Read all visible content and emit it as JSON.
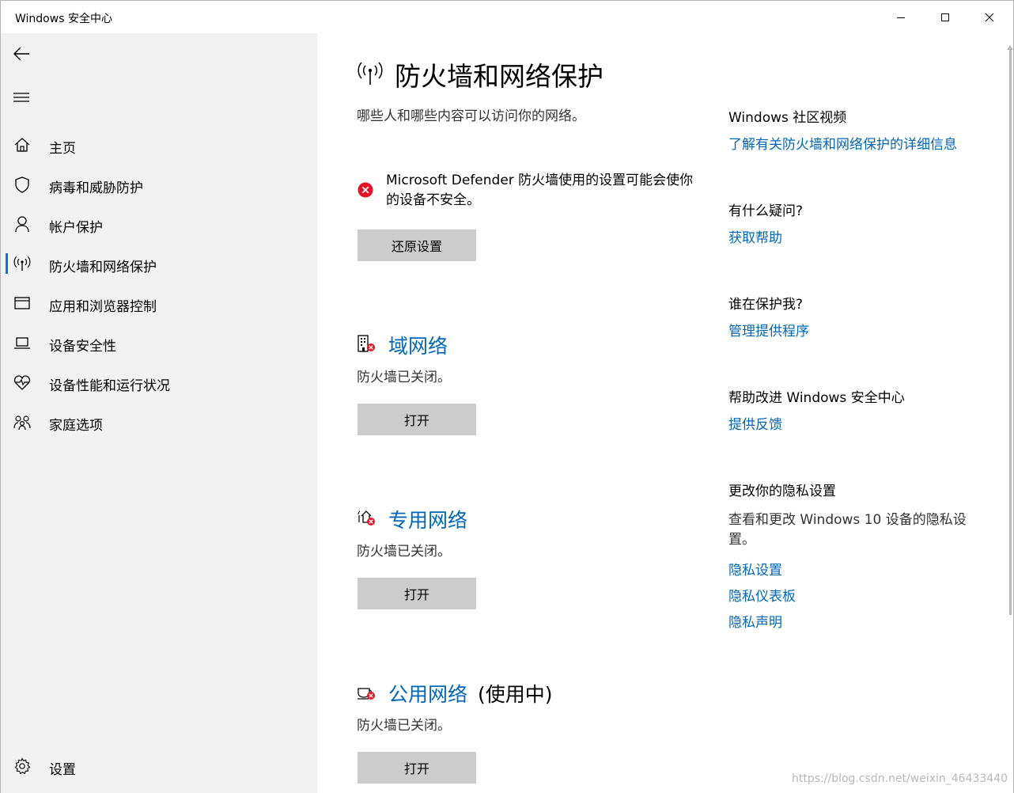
{
  "window": {
    "title": "Windows 安全中心"
  },
  "sidebar": {
    "items": [
      {
        "label": "主页",
        "icon": "home-icon"
      },
      {
        "label": "病毒和威胁防护",
        "icon": "shield-icon"
      },
      {
        "label": "帐户保护",
        "icon": "person-icon"
      },
      {
        "label": "防火墙和网络保护",
        "icon": "wifi-antenna-icon",
        "active": true
      },
      {
        "label": "应用和浏览器控制",
        "icon": "browser-window-icon"
      },
      {
        "label": "设备安全性",
        "icon": "laptop-icon"
      },
      {
        "label": "设备性能和运行状况",
        "icon": "heart-pulse-icon"
      },
      {
        "label": "家庭选项",
        "icon": "family-icon"
      }
    ],
    "settings_label": "设置"
  },
  "main": {
    "title": "防火墙和网络保护",
    "subtitle": "哪些人和哪些内容可以访问你的网络。",
    "warning": {
      "text": "Microsoft Defender 防火墙使用的设置可能会使你的设备不安全。",
      "button": "还原设置"
    },
    "networks": [
      {
        "name": "域网络",
        "suffix": "",
        "status": "防火墙已关闭。",
        "button": "打开",
        "icon": "domain-network-icon"
      },
      {
        "name": "专用网络",
        "suffix": "",
        "status": "防火墙已关闭。",
        "button": "打开",
        "icon": "private-network-icon"
      },
      {
        "name": "公用网络",
        "suffix": "(使用中)",
        "status": "防火墙已关闭。",
        "button": "打开",
        "icon": "public-network-icon"
      }
    ]
  },
  "right": {
    "community": {
      "heading": "Windows 社区视频",
      "link": "了解有关防火墙和网络保护的详细信息"
    },
    "help": {
      "heading": "有什么疑问?",
      "link": "获取帮助"
    },
    "protect": {
      "heading": "谁在保护我?",
      "link": "管理提供程序"
    },
    "improve": {
      "heading": "帮助改进 Windows 安全中心",
      "link": "提供反馈"
    },
    "privacy": {
      "heading": "更改你的隐私设置",
      "text": "查看和更改 Windows 10 设备的隐私设置。",
      "links": [
        "隐私设置",
        "隐私仪表板",
        "隐私声明"
      ]
    }
  },
  "watermark": "https://blog.csdn.net/weixin_46433440",
  "colors": {
    "accent": "#0078d7",
    "link": "#0067b8",
    "sidebar_bg": "#f2f2f2",
    "button_bg": "#cccccc",
    "error_red": "#e81123"
  }
}
